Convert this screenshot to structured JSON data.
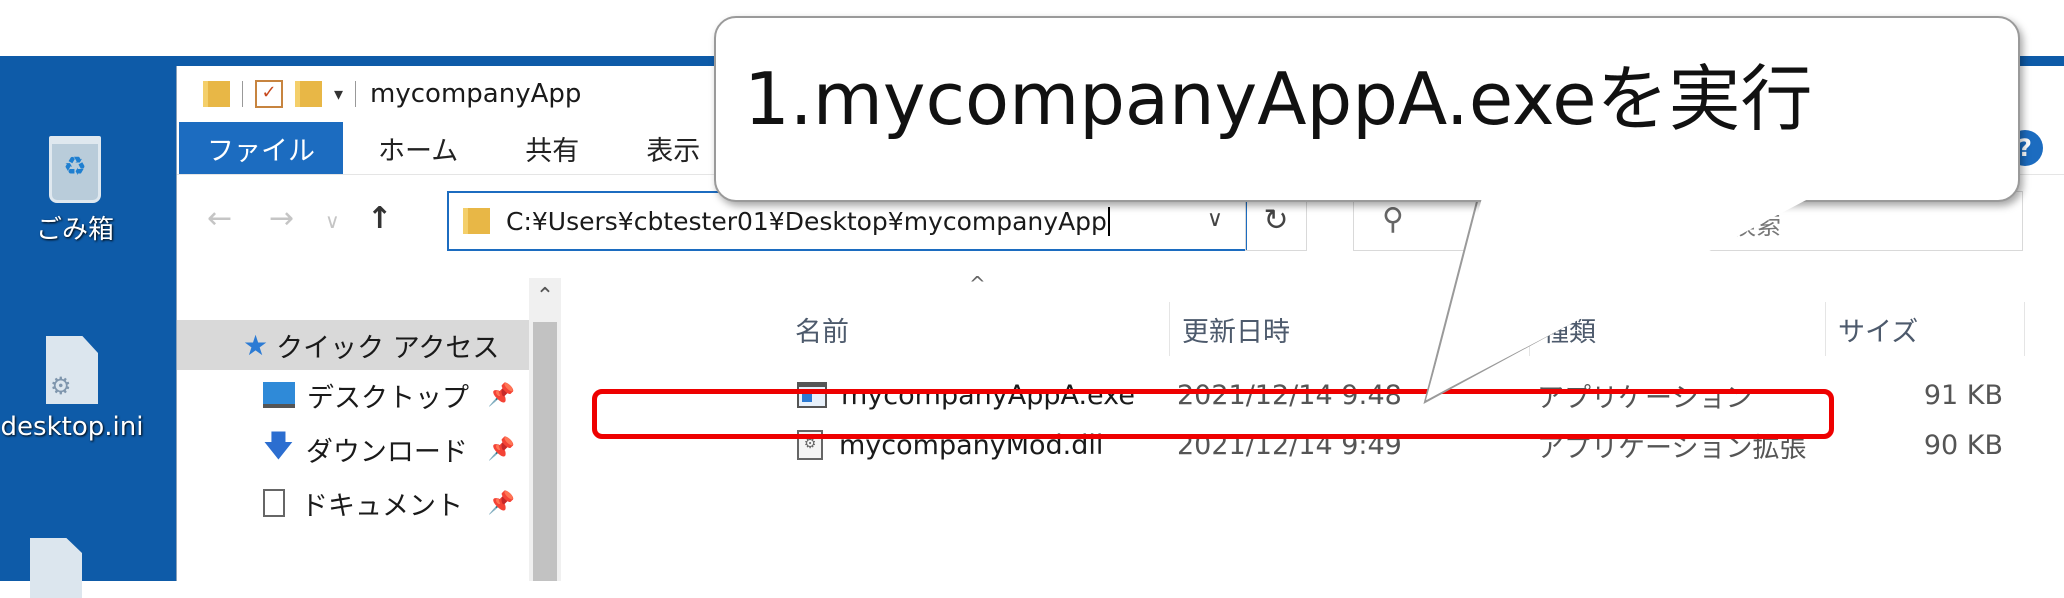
{
  "desktop": {
    "icons": [
      {
        "label": "ごみ箱",
        "icon": "recycle-bin-icon"
      },
      {
        "label": "desktop.ini",
        "icon": "settings-file-icon"
      }
    ],
    "background_color": "#0e5ba8"
  },
  "window": {
    "title": "mycompanyApp",
    "ribbon_tabs": [
      "ファイル",
      "ホーム",
      "共有",
      "表示"
    ],
    "address": "C:¥Users¥cbtester01¥Desktop¥mycompanyApp",
    "search_placeholder": "の検索",
    "help_label": "?"
  },
  "nav_pane": {
    "quick_access": "クイック アクセス",
    "items": [
      {
        "label": "デスクトップ",
        "icon": "desktop-icon",
        "pinned": true
      },
      {
        "label": "ダウンロード",
        "icon": "download-arrow-icon",
        "pinned": true
      },
      {
        "label": "ドキュメント",
        "icon": "document-icon",
        "pinned": true
      }
    ]
  },
  "file_list": {
    "columns": [
      "名前",
      "更新日時",
      "種類",
      "サイズ"
    ],
    "rows": [
      {
        "name": "mycompanyAppA.exe",
        "date": "2021/12/14 9:48",
        "type": "アプリケーション",
        "size": "91 KB",
        "icon": "exe-icon"
      },
      {
        "name": "mycompanyMod.dll",
        "date": "2021/12/14 9:49",
        "type": "アプリケーション拡張",
        "size": "90 KB",
        "icon": "dll-icon"
      }
    ]
  },
  "callout": {
    "text": "1.mycompanyAppA.exeを実行"
  },
  "colors": {
    "accent": "#1c6cc0",
    "highlight": "#ee0000"
  }
}
